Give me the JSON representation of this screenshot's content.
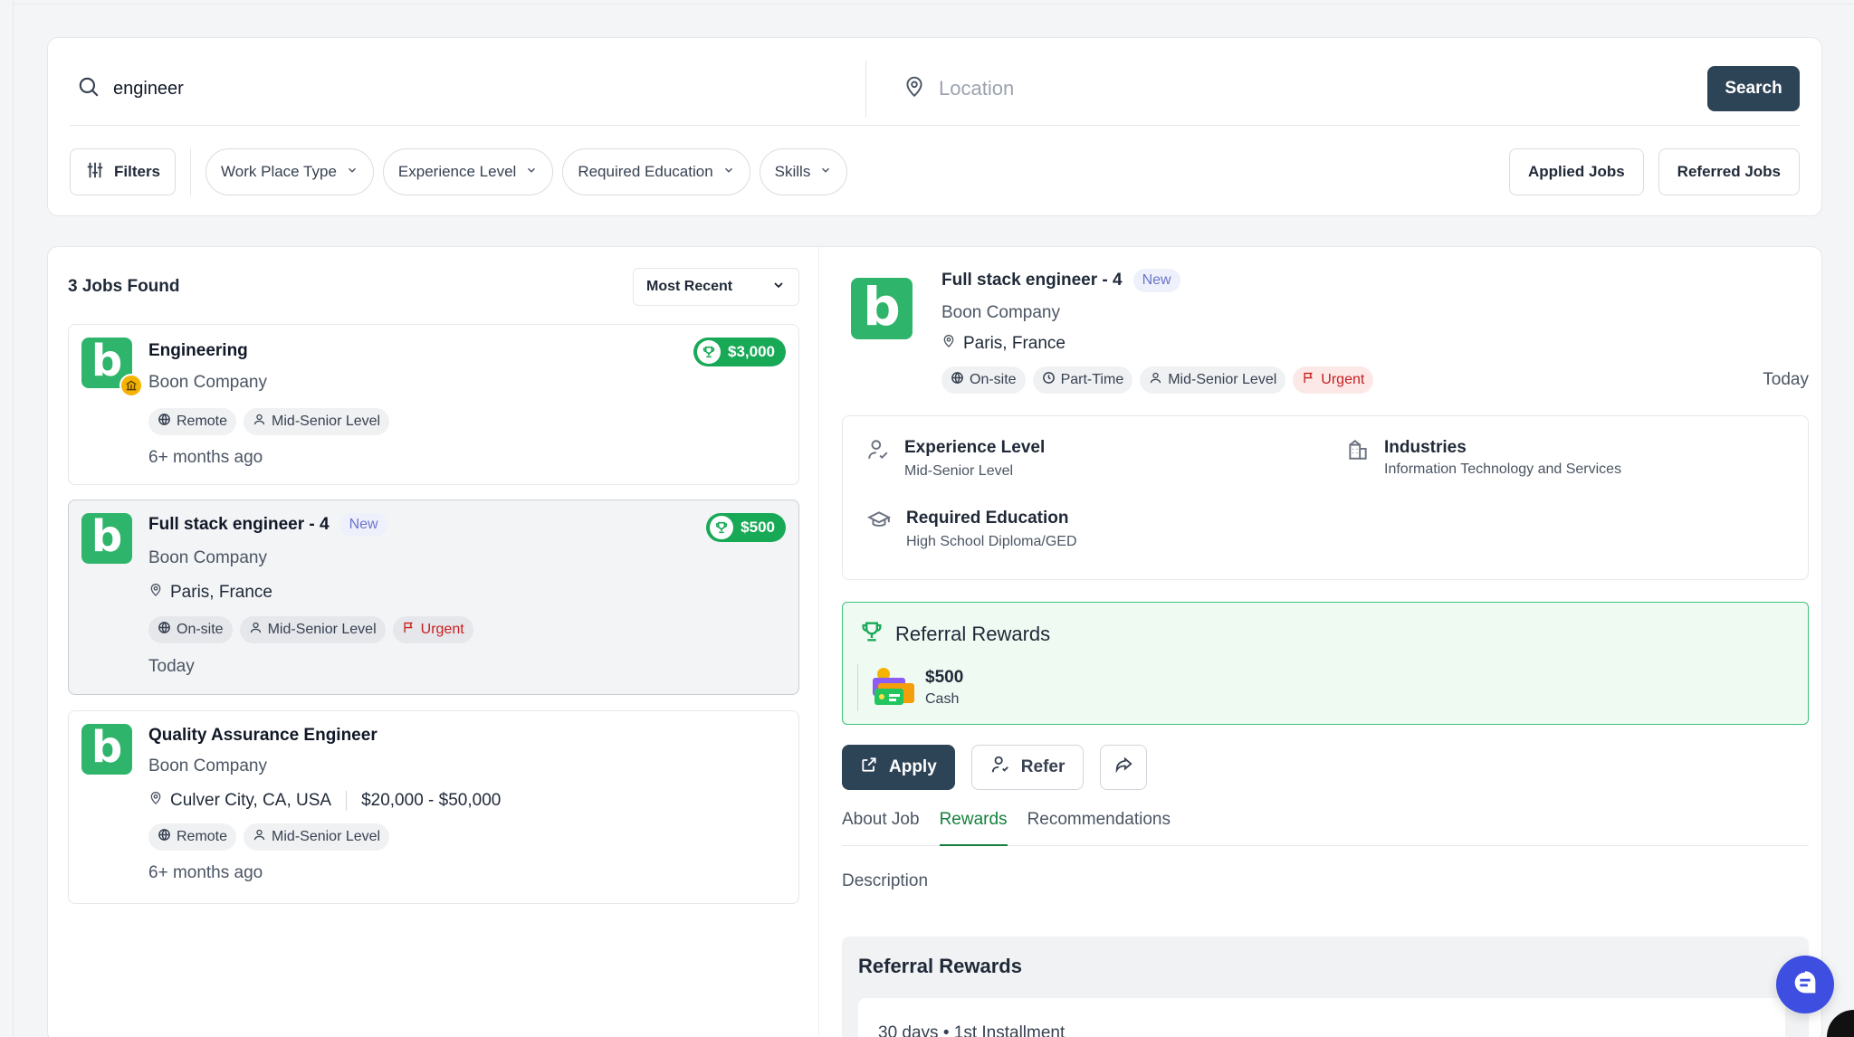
{
  "search": {
    "query": "engineer",
    "location_placeholder": "Location",
    "button": "Search"
  },
  "filters": {
    "filters_label": "Filters",
    "dropdowns": [
      "Work Place Type",
      "Experience Level",
      "Required Education",
      "Skills"
    ],
    "applied_jobs": "Applied Jobs",
    "referred_jobs": "Referred Jobs"
  },
  "list": {
    "count_label": "3 Jobs Found",
    "sort_label": "Most Recent",
    "jobs": [
      {
        "title": "Engineering",
        "company": "Boon Company",
        "reward": "$3,000",
        "tags": [
          "Remote",
          "Mid-Senior Level"
        ],
        "posted": "6+ months ago"
      },
      {
        "title": "Full stack engineer - 4",
        "badge": "New",
        "company": "Boon Company",
        "location": "Paris, France",
        "reward": "$500",
        "tags": [
          "On-site",
          "Mid-Senior Level",
          "Urgent"
        ],
        "posted": "Today"
      },
      {
        "title": "Quality Assurance Engineer",
        "company": "Boon Company",
        "location": "Culver City, CA, USA",
        "salary": "$20,000 - $50,000",
        "tags": [
          "Remote",
          "Mid-Senior Level"
        ],
        "posted": "6+ months ago"
      }
    ]
  },
  "detail": {
    "title": "Full stack engineer - 4",
    "badge": "New",
    "company": "Boon Company",
    "location": "Paris, France",
    "tags": [
      "On-site",
      "Part-Time",
      "Mid-Senior Level",
      "Urgent"
    ],
    "date": "Today",
    "experience_label": "Experience Level",
    "experience_value": "Mid-Senior Level",
    "industries_label": "Industries",
    "industries_value": "Information Technology and Services",
    "education_label": "Required Education",
    "education_value": "High School Diploma/GED",
    "rewards_title": "Referral Rewards",
    "reward_amount": "$500",
    "reward_type": "Cash",
    "apply": "Apply",
    "refer": "Refer",
    "tabs": [
      "About Job",
      "Rewards",
      "Recommendations"
    ],
    "active_tab": "Rewards",
    "description_label": "Description",
    "rr_title": "Referral Rewards",
    "installment": "30 days • 1st Installment"
  },
  "colors": {
    "primary": "#2d4356",
    "green": "#18a957",
    "urgent": "#c81e1e",
    "fab": "#3d4ee0"
  }
}
